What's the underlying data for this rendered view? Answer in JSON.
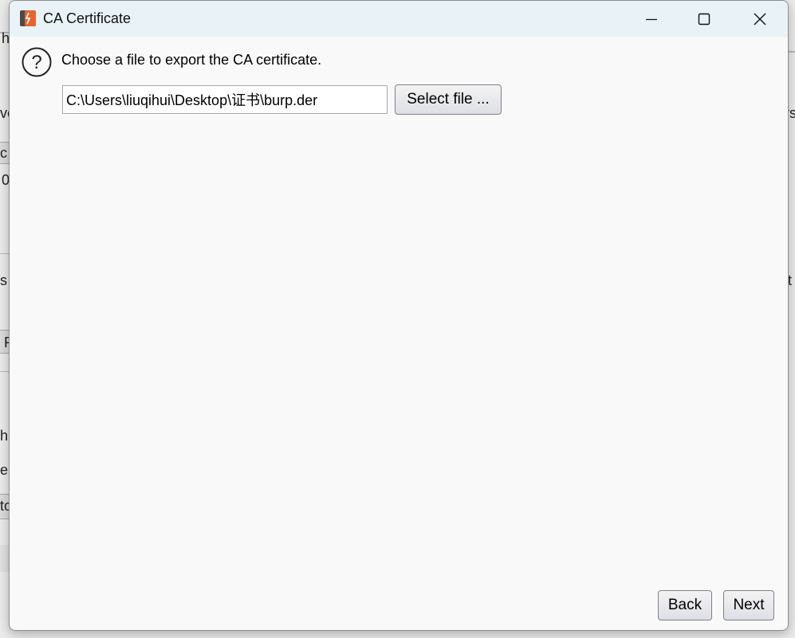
{
  "dialog": {
    "title": "CA Certificate",
    "prompt": "Choose a file to export the CA certificate.",
    "file_path": "C:\\Users\\liuqihui\\Desktop\\证书\\burp.der",
    "select_file_label": "Select file ...",
    "back_label": "Back",
    "next_label": "Next"
  },
  "background_fragments": {
    "left": [
      "h",
      "ve",
      "c",
      "0",
      "s",
      "F",
      "h",
      "e",
      "to"
    ],
    "right": [
      "rs",
      "t"
    ]
  },
  "icons": {
    "app": "burp-logo-icon",
    "help": "question-circle-icon",
    "minimize": "minimize-icon",
    "maximize": "maximize-icon",
    "close": "close-icon"
  },
  "colors": {
    "titlebar": "#e9f3f7",
    "dialog_bg": "#f9f9f9",
    "brand_orange": "#e8642c"
  }
}
